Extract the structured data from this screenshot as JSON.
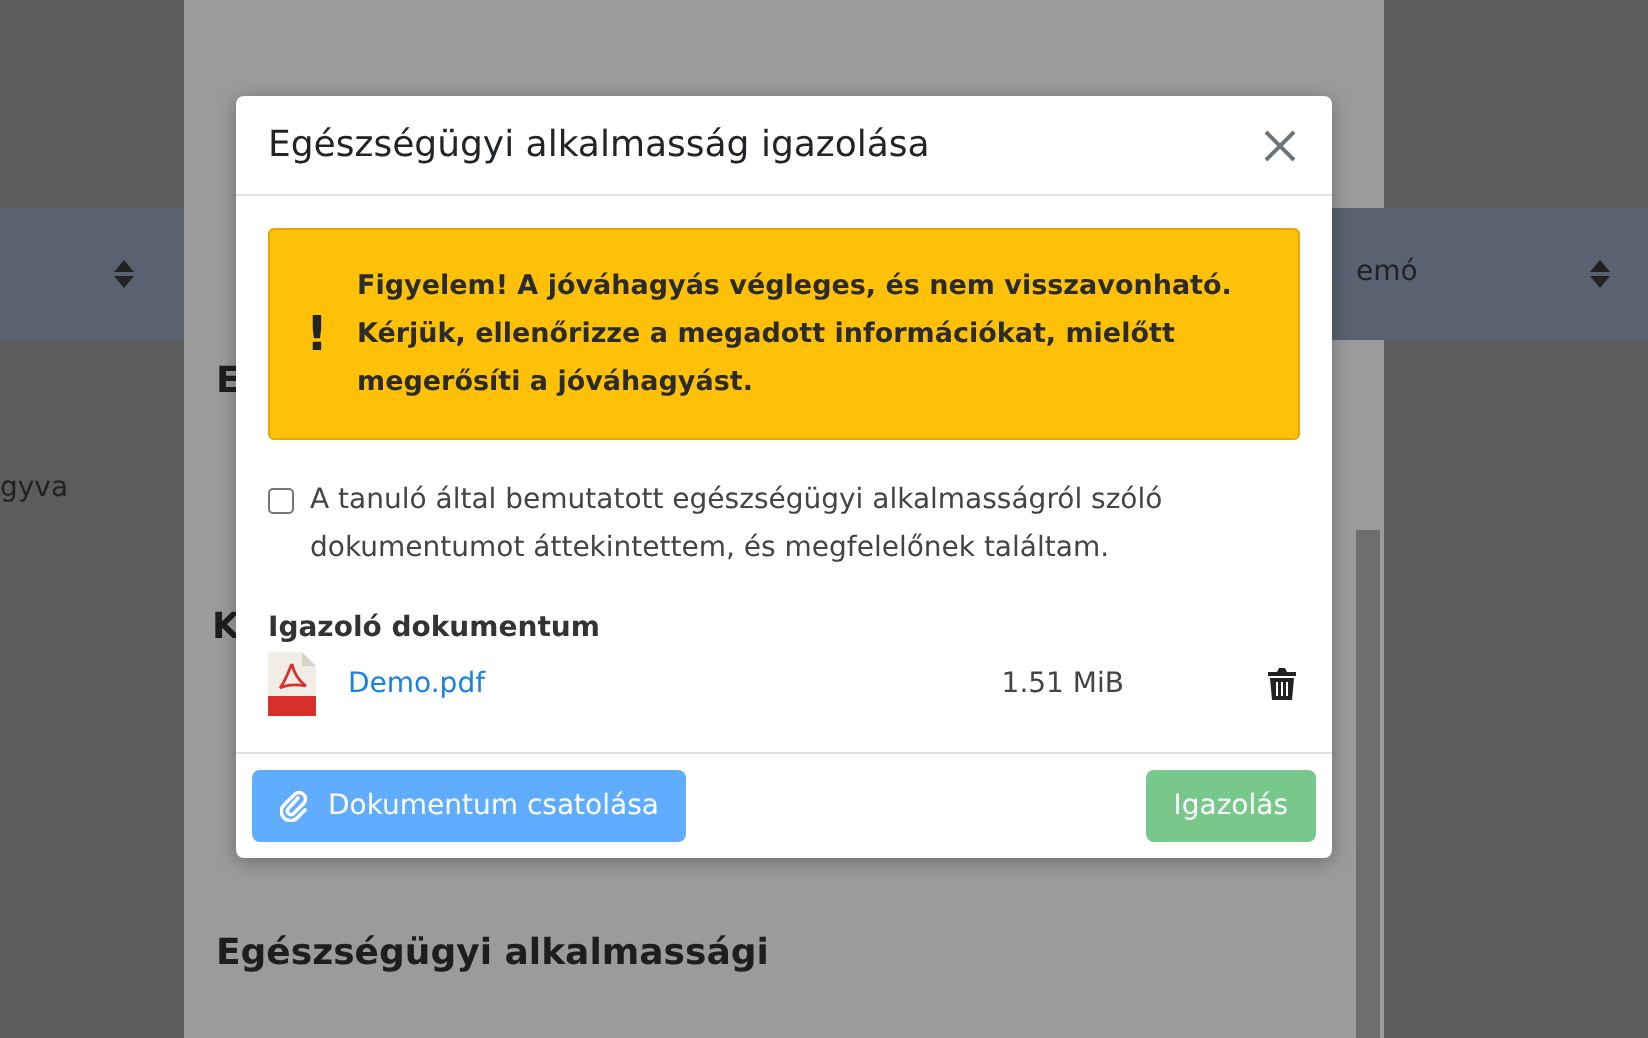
{
  "background": {
    "table_left_fragment": "gyva",
    "table_right_header": "emó",
    "side_heading_1": "E",
    "side_heading_2": "K",
    "bottom_title": "Egészségügyi alkalmassági"
  },
  "modal": {
    "title": "Egészségügyi alkalmasság igazolása",
    "alert": {
      "icon": "!",
      "lines": [
        "Figyelem! A jóváhagyás végleges, és nem visszavonható.",
        "Kérjük, ellenőrizze a megadott információkat, mielőtt megerősíti a jóváhagyást."
      ]
    },
    "confirmation": {
      "label": "A tanuló által bemutatott egészségügyi alkalmasságról szóló dokumentumot áttekintettem, és megfelelőnek találtam.",
      "checked": false
    },
    "documents_heading": "Igazoló dokumentum",
    "documents": [
      {
        "name": "Demo.pdf",
        "size": "1.51 MiB"
      }
    ],
    "buttons": [
      {
        "kind": "attach",
        "label": "Dokumentum csatolása",
        "disabled": true
      },
      {
        "kind": "confirm",
        "label": "Igazolás",
        "disabled": true
      }
    ]
  }
}
